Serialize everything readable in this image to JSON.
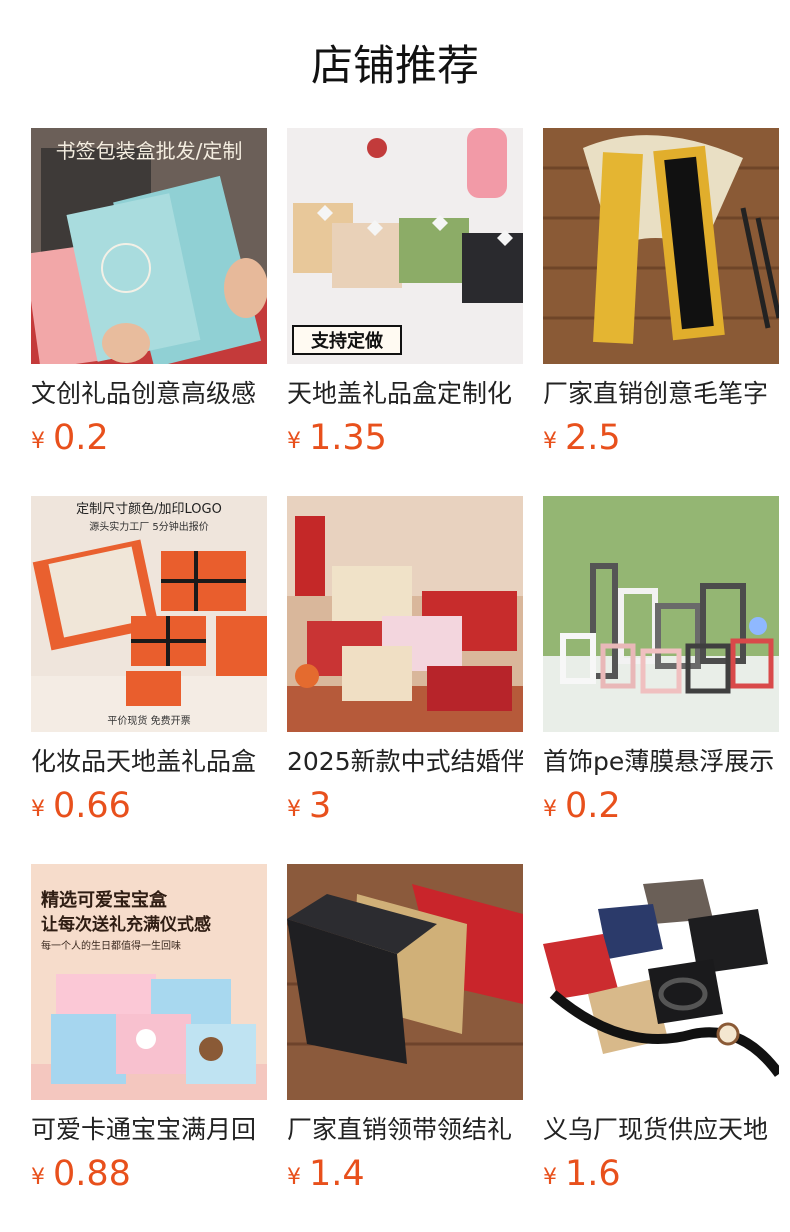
{
  "header": {
    "title": "店铺推荐"
  },
  "products": [
    {
      "name": "文创礼品创意高级感",
      "currency": "¥",
      "price": "0.2",
      "image_text": "书签包装盒批发/定制"
    },
    {
      "name": "天地盖礼品盒定制化",
      "currency": "¥",
      "price": "1.35",
      "image_text": "支持定做"
    },
    {
      "name": "厂家直销创意毛笔字",
      "currency": "¥",
      "price": "2.5",
      "image_text": ""
    },
    {
      "name": "化妆品天地盖礼品盒",
      "currency": "¥",
      "price": "0.66",
      "image_text": "定制尺寸颜色/加印LOGO",
      "image_text2": "源头实力工厂 5分钟出报价",
      "image_text3": "平价现货 免费开票"
    },
    {
      "name": "2025新款中式结婚伴",
      "currency": "¥",
      "price": "3",
      "image_text": ""
    },
    {
      "name": "首饰pe薄膜悬浮展示",
      "currency": "¥",
      "price": "0.2",
      "image_text": ""
    },
    {
      "name": "可爱卡通宝宝满月回",
      "currency": "¥",
      "price": "0.88",
      "image_text": "精选可爱宝宝盒",
      "image_text2": "让每次送礼充满仪式感",
      "image_text3": "每一个人的生日都值得一生回味"
    },
    {
      "name": "厂家直销领带领结礼",
      "currency": "¥",
      "price": "1.4",
      "image_text": ""
    },
    {
      "name": "义乌厂现货供应天地",
      "currency": "¥",
      "price": "1.6",
      "image_text": ""
    }
  ]
}
